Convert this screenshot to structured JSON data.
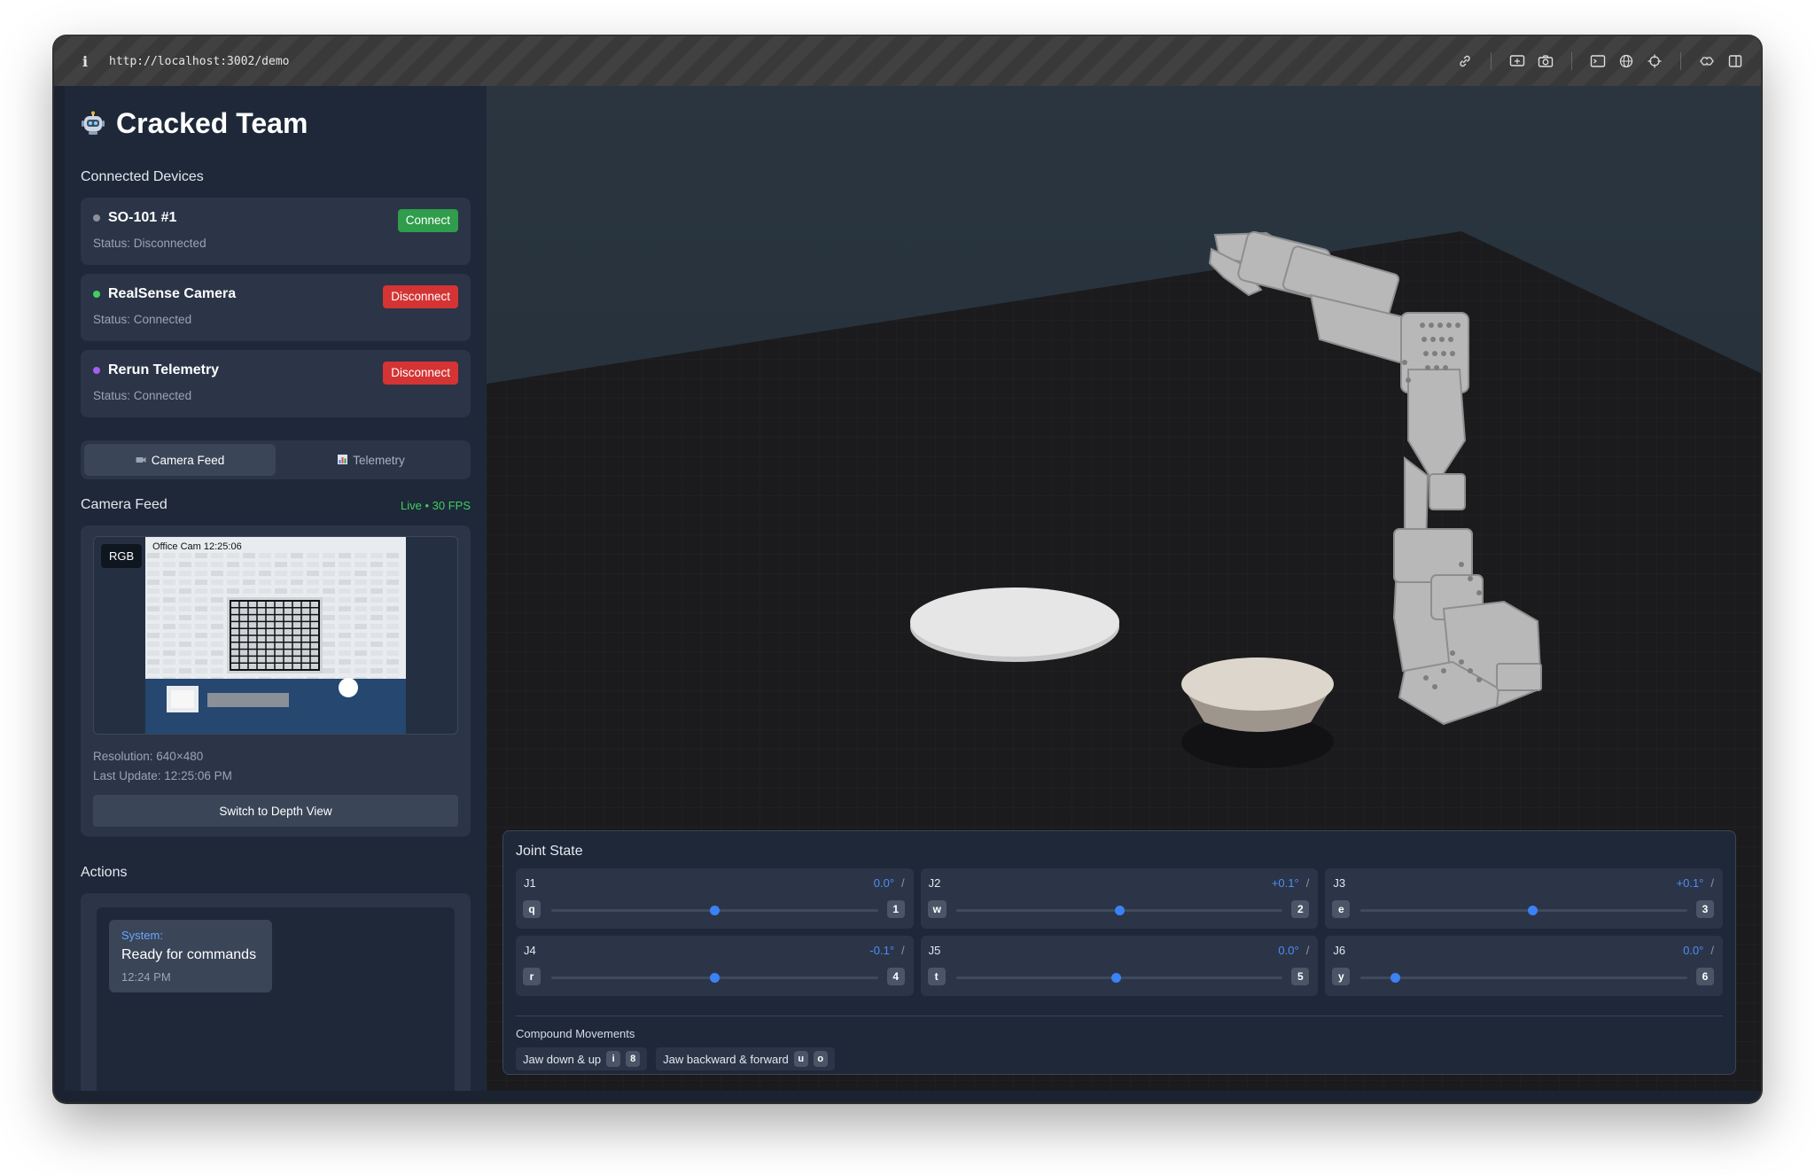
{
  "browser": {
    "url": "http://localhost:3002/demo",
    "info_icon": "info-icon",
    "tools": [
      "link-icon",
      "screenshot-icon",
      "camera-icon",
      "terminal-icon",
      "globe-icon",
      "crosshair-icon",
      "extension-icon",
      "split-view-icon"
    ]
  },
  "sidebar": {
    "title": "Cracked Team",
    "devices_title": "Connected Devices",
    "devices": [
      {
        "name": "SO-101 #1",
        "status": "Status: Disconnected",
        "action": "Connect",
        "dot_color": "#8a8f98",
        "action_color": "#2f9d4c"
      },
      {
        "name": "RealSense Camera",
        "status": "Status: Connected",
        "action": "Disconnect",
        "dot_color": "#3fcf5f",
        "action_color": "#d43434"
      },
      {
        "name": "Rerun Telemetry",
        "status": "Status: Connected",
        "action": "Disconnect",
        "dot_color": "#a45ef0",
        "action_color": "#d43434"
      }
    ],
    "tabs": [
      {
        "icon": "video-camera-icon",
        "label": "Camera Feed",
        "active": true
      },
      {
        "icon": "bar-chart-icon",
        "label": "Telemetry",
        "active": false
      }
    ],
    "camera": {
      "title": "Camera Feed",
      "live": "Live • 30 FPS",
      "badge": "RGB",
      "overlay": "Office Cam  12:25:06",
      "resolution": "Resolution: 640×480",
      "last_update": "Last Update: 12:25:06 PM",
      "switch_label": "Switch to Depth View"
    },
    "actions": {
      "title": "Actions",
      "messages": [
        {
          "who": "System:",
          "text": "Ready for commands",
          "time": "12:24 PM"
        }
      ]
    }
  },
  "joint_state": {
    "title": "Joint State",
    "joints": [
      {
        "name": "J1",
        "value": "0.0°",
        "slider": 0.5,
        "key_left": "q",
        "key_right": "1"
      },
      {
        "name": "J2",
        "value": "+0.1°",
        "slider": 0.5,
        "key_left": "w",
        "key_right": "2"
      },
      {
        "name": "J3",
        "value": "+0.1°",
        "slider": 0.525,
        "key_left": "e",
        "key_right": "3"
      },
      {
        "name": "J4",
        "value": "-0.1°",
        "slider": 0.5,
        "key_left": "r",
        "key_right": "4"
      },
      {
        "name": "J5",
        "value": "0.0°",
        "slider": 0.49,
        "key_left": "t",
        "key_right": "5"
      },
      {
        "name": "J6",
        "value": "0.0°",
        "slider": 0.105,
        "key_left": "y",
        "key_right": "6"
      }
    ],
    "slash": "/",
    "compound_title": "Compound Movements",
    "compound": [
      {
        "label": "Jaw down & up",
        "keys": [
          "i",
          "8"
        ]
      },
      {
        "label": "Jaw backward & forward",
        "keys": [
          "u",
          "o"
        ]
      }
    ]
  },
  "colors": {
    "accent": "#3b82f6",
    "live": "#3fcf5f",
    "connect": "#2f9d4c",
    "disconnect": "#d43434"
  }
}
